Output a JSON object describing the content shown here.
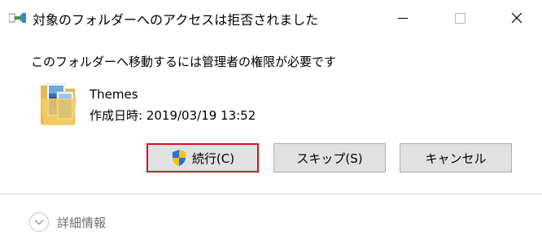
{
  "window": {
    "title": "対象のフォルダーへのアクセスは拒否されました"
  },
  "message": "このフォルダーへ移動するには管理者の権限が必要です",
  "item": {
    "name": "Themes",
    "created": "作成日時: 2019/03/19 13:52",
    "icon": "folder-icon"
  },
  "buttons": {
    "continue_label": "続行(C)",
    "skip_label": "スキップ(S)",
    "cancel_label": "キャンセル"
  },
  "details": {
    "label": "詳細情報"
  },
  "colors": {
    "highlight": "#d0161e",
    "button_bg": "#e1e1e1",
    "button_border": "#adadad"
  }
}
